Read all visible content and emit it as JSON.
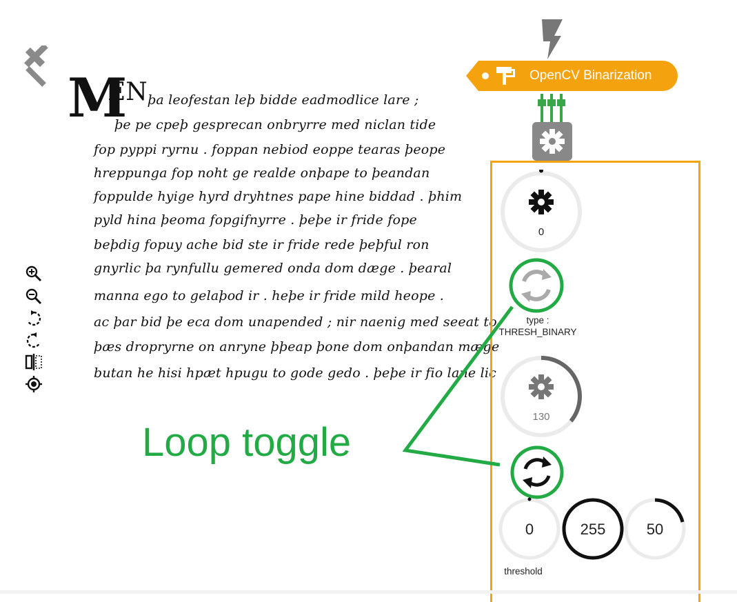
{
  "node": {
    "title": "OpenCV Binarization",
    "accent_color": "#f5a20f",
    "icons": [
      "lightning-bolt-icon",
      "paint-roller-icon",
      "gear-icon"
    ]
  },
  "panel": {
    "knob1_value": "0",
    "type_label_line1": "type :",
    "type_label_line2": "THRESH_BINARY",
    "knob2_value": "130",
    "knob2_level_fraction": 0.36,
    "threshold_values": [
      "0",
      "255",
      "50"
    ],
    "threshold_label": "threshold"
  },
  "annotation": {
    "text": "Loop toggle",
    "color": "#22aa44"
  },
  "toolbar": {
    "icons": [
      "zoom-in-icon",
      "zoom-out-icon",
      "rotate-left-icon",
      "rotate-right-icon",
      "flip-horizontal-icon",
      "recenter-icon"
    ]
  },
  "manuscript": {
    "initial": "M",
    "initial_rest": "EN",
    "lines": [
      "þa leofestan leþ bidde eadmodlice lare ;",
      "þe pe cpeþ gesprecan onbryrre med niclan tide",
      "fop pyppi ryrnu . foppan nebiod eoppe tearas þeope",
      "hreppunga fop noht ge realde onþape to þeandan",
      "foppulde hyige hyrd dryhtnes pape hine biddad . þhim",
      "pyld hina þeoma fopgifnyrre . þeþe ir fride fope",
      "beþdig fopuy ache bid ste ir fride rede þeþful ron",
      "gnyrlic þa rynfullu gemered onda dom dæge . þearal",
      "manna ego to gelaþod ir . heþe ir fride mild heope .",
      "ac þar bid þe eca dom unapended ; nir naenig med seeat to",
      "þæs dropryrne on anryne þþeap þone dom onþandan mæge",
      "butan he hisi hpæt hpugu to gode gedo . þeþe ir fio lane lic"
    ]
  }
}
